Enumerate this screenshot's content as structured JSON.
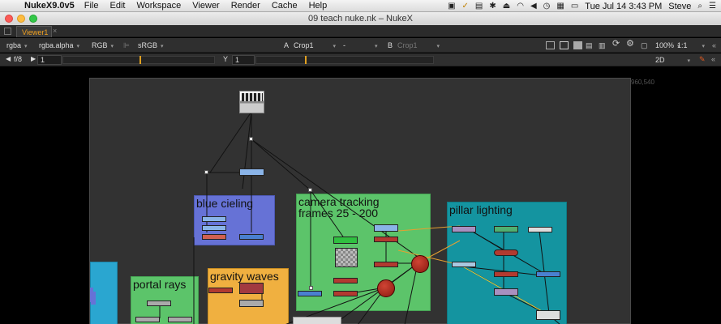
{
  "menubar": {
    "app_name": "NukeX9.0v5",
    "items": [
      "File",
      "Edit",
      "Workspace",
      "Viewer",
      "Render",
      "Cache",
      "Help"
    ],
    "date_time": "Tue Jul 14  3:43 PM",
    "user": "Steve"
  },
  "window": {
    "title": "09 teach nuke.nk – NukeX"
  },
  "tabs": [
    {
      "label": "Viewer1"
    }
  ],
  "viewer_controls": {
    "channels": "rgba",
    "alpha": "rgba.alpha",
    "display": "RGB",
    "colorspace": "sRGB",
    "a_label": "A",
    "a_input": "Crop1",
    "compare": "-",
    "b_label": "B",
    "b_input": "Crop1",
    "zoom": "100%",
    "proxy": "1:1",
    "mode": "2D",
    "fstop": "f/8",
    "gain": "1",
    "y_label": "Y",
    "gamma": "1"
  },
  "viewer": {
    "resolution": "960,540"
  },
  "backdrops": [
    {
      "label": "blue cieling",
      "color": "#6672d6"
    },
    {
      "label": "camera tracking\nframes 25 - 200",
      "color": "#5cc46a"
    },
    {
      "label": "pillar lighting",
      "color": "#1494a0"
    },
    {
      "label": "gravity waves",
      "color": "#f0b040"
    },
    {
      "label": "portal rays",
      "color": "#5cc46a"
    },
    {
      "label": "",
      "color": "#2aa6d0"
    }
  ]
}
